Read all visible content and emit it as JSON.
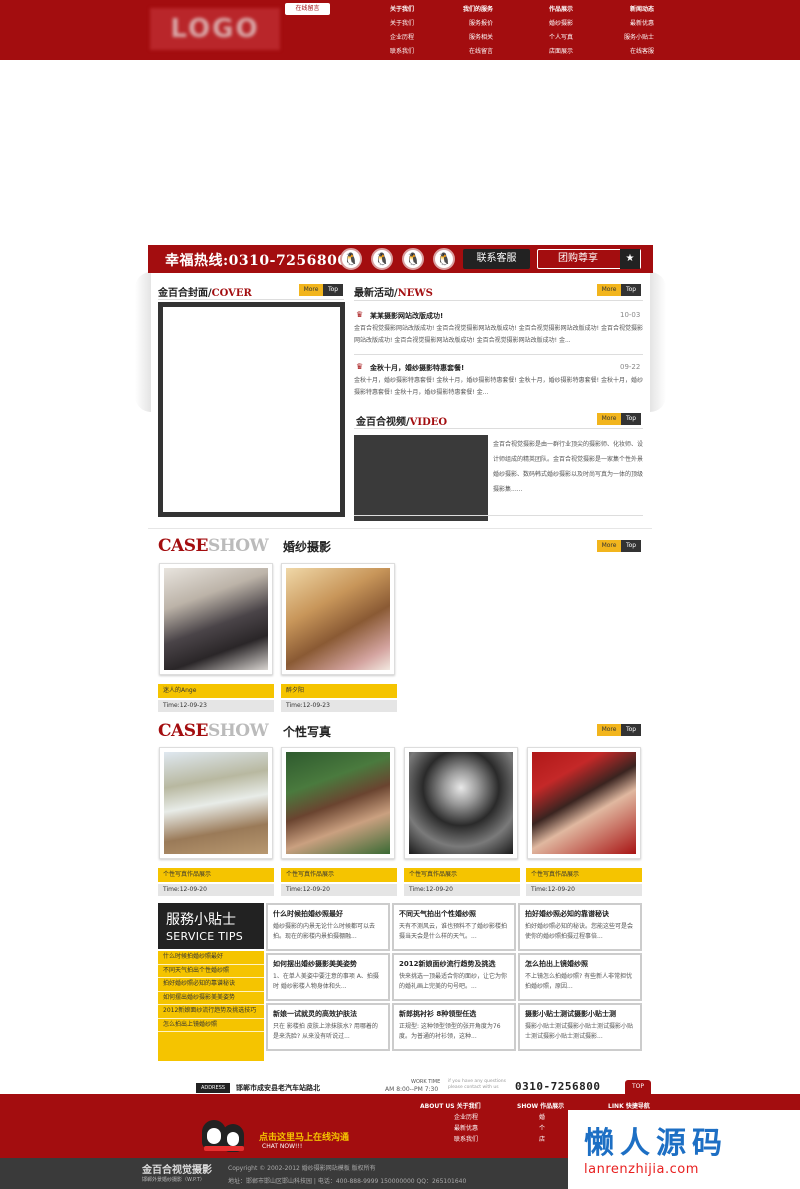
{
  "header": {
    "logo_text": "LOGO",
    "online_tab": "在线留言",
    "nav": [
      {
        "title": "关于我们",
        "items": [
          "关于我们",
          "企业历程",
          "联系我们"
        ]
      },
      {
        "title": "我们的服务",
        "items": [
          "服务报价",
          "服务相关",
          "在线留言"
        ]
      },
      {
        "title": "作品展示",
        "items": [
          "婚纱摄影",
          "个人写真",
          "店面展示"
        ]
      },
      {
        "title": "新闻动态",
        "items": [
          "最新优惠",
          "服务小贴士",
          "在线客服"
        ]
      }
    ]
  },
  "hotline": {
    "text": "幸福热线:0310-7256800",
    "contact_label": "联系客服",
    "group_label": "团购尊享",
    "qq_icon": "qq-penguin-icon"
  },
  "cover": {
    "title_cn": "金百合封面/",
    "title_en": "COVER",
    "more": "More",
    "top": "Top"
  },
  "news": {
    "title_cn": "最新活动/",
    "title_en": "NEWS",
    "more": "More",
    "top": "Top",
    "items": [
      {
        "title": "某某摄影网站改版成功!",
        "date": "10-03",
        "body": "金百合视觉摄影网站改版成功! 金百合视觉摄影网站改版成功! 金百合视觉摄影网站改版成功! 金百合视觉摄影网站改版成功! 金百合视觉摄影网站改版成功! 金百合视觉摄影网站改版成功! 金..."
      },
      {
        "title": "金秋十月，婚纱摄影特惠套餐!",
        "date": "09-22",
        "body": "金秋十月，婚纱摄影特惠套餐! 金秋十月，婚纱摄影特惠套餐! 金秋十月，婚纱摄影特惠套餐! 金秋十月，婚纱摄影特惠套餐! 金秋十月，婚纱摄影特惠套餐! 金..."
      }
    ]
  },
  "video": {
    "title_cn": "金百合视频/",
    "title_en": "VIDEO",
    "more": "More",
    "top": "Top",
    "text": "金百合视觉摄影是由一群行业顶尖的摄影师、化妆师、设计师组成的精英团队。金百合视觉摄影是一家集个性外景婚纱摄影、数码韩式婚纱摄影以及时尚写真为一体的顶级摄影集......"
  },
  "case_wedding": {
    "logo_case": "CASE",
    "logo_show": "SHOW",
    "sub": "婚纱摄影",
    "more": "More",
    "top": "Top",
    "items": [
      {
        "caption": "迷人的Ange",
        "time": "Time:12-09-23"
      },
      {
        "caption": "醉夕阳",
        "time": "Time:12-09-23"
      }
    ]
  },
  "case_portrait": {
    "logo_case": "CASE",
    "logo_show": "SHOW",
    "sub": "个性写真",
    "more": "More",
    "top": "Top",
    "items": [
      {
        "caption": "个性写真作品展示",
        "time": "Time:12-09-20"
      },
      {
        "caption": "个性写真作品展示",
        "time": "Time:12-09-20"
      },
      {
        "caption": "个性写真作品展示",
        "time": "Time:12-09-20"
      },
      {
        "caption": "个性写真作品展示",
        "time": "Time:12-09-20"
      }
    ]
  },
  "tips": {
    "head_cn": "服務小貼士",
    "head_en": "SERVICE TIPS",
    "list": [
      "什么时候拍婚纱照最好",
      "不同天气拍出个性婚纱照",
      "拍好婚纱照必知的靠谱秘诀",
      "如何摆出婚纱摄影美美姿势",
      "2012新娘面纱流行趋势及挑选技巧",
      "怎么拍出上镜婚纱照"
    ],
    "cells": [
      {
        "title": "什么时候拍婚纱照最好",
        "body": "婚纱摄影的内景无论什么时候都可以去拍。现在的影楼内景拍摄棚融..."
      },
      {
        "title": "不同天气拍出个性婚纱照",
        "body": "天有不测风云，谁也预料不了婚纱影楼拍摄当天会是什么样的天气。..."
      },
      {
        "title": "拍好婚纱照必知的靠谱秘诀",
        "body": "拍好婚纱照必知的秘诀。您能这些可是会使你的婚纱照拍摄过程事倍..."
      },
      {
        "title": "如何摆出婚纱摄影美美姿势",
        "body": "1、在单人美姿中要注意的事项 A、拍摄时 婚纱影楼人物身体和头..."
      },
      {
        "title": "2012新娘面纱流行趋势及挑选",
        "body": "快来挑选一顶最适合你的面纱，让它为你的婚礼画上完美的句号吧。..."
      },
      {
        "title": "怎么拍出上镜婚纱照",
        "body": "不上镜怎么拍婚纱照? 有些新人非常担忧拍婚纱照，原因..."
      },
      {
        "title": "新娘一试就灵的高效护肤法",
        "body": "只在 影楼拍 皮肤上涂抹肤水? 用哪着的是来洗脸? 从来没有听说过..."
      },
      {
        "title": "新郎挑衬衫 8种领型任选",
        "body": "正规型: 这种领型领型的张开角度为76度。为普通的衬衫领，这种..."
      },
      {
        "title": "摄影小贴士测试摄影小贴士测",
        "body": "摄影小贴士测试摄影小贴士测试摄影小贴士测试摄影小贴士测试摄影..."
      }
    ]
  },
  "address_bar": {
    "label": "ADDRESS",
    "address": "邯郸市成安县老汽车站路北",
    "work_time_label": "WORK TIME",
    "work_time": "AM 8:00--PM 7:30",
    "note_1": "if you have any questions",
    "note_2": "please contact with us",
    "phone": "0310-7256800",
    "top": "TOP"
  },
  "footer": {
    "chat_text": "点击这里马上在线沟通",
    "chat_en": "CHAT NOW!!!",
    "cols": [
      {
        "title": "ABOUT US 关于我们",
        "items": [
          "企业历程",
          "最新优惠",
          "联系我们"
        ]
      },
      {
        "title": "SHOW 作品展示",
        "items": [
          "婚",
          "个",
          "店"
        ]
      },
      {
        "title": "LINK 快捷导航",
        "items": []
      }
    ],
    "brand": "金百合视觉摄影",
    "brand_sub": "邯郸外景婚纱摄影（W.P.T）",
    "copyright": "Copyright © 2002-2012 婚纱摄影网站模板 版权所有",
    "address_line": "地址：邯郸市邯山区邯山科技园  |  电话：400-888-9999 150000000  QQ：265101640"
  },
  "watermark": {
    "cn": "懒人源码",
    "url": "lanrenzhijia.com"
  }
}
